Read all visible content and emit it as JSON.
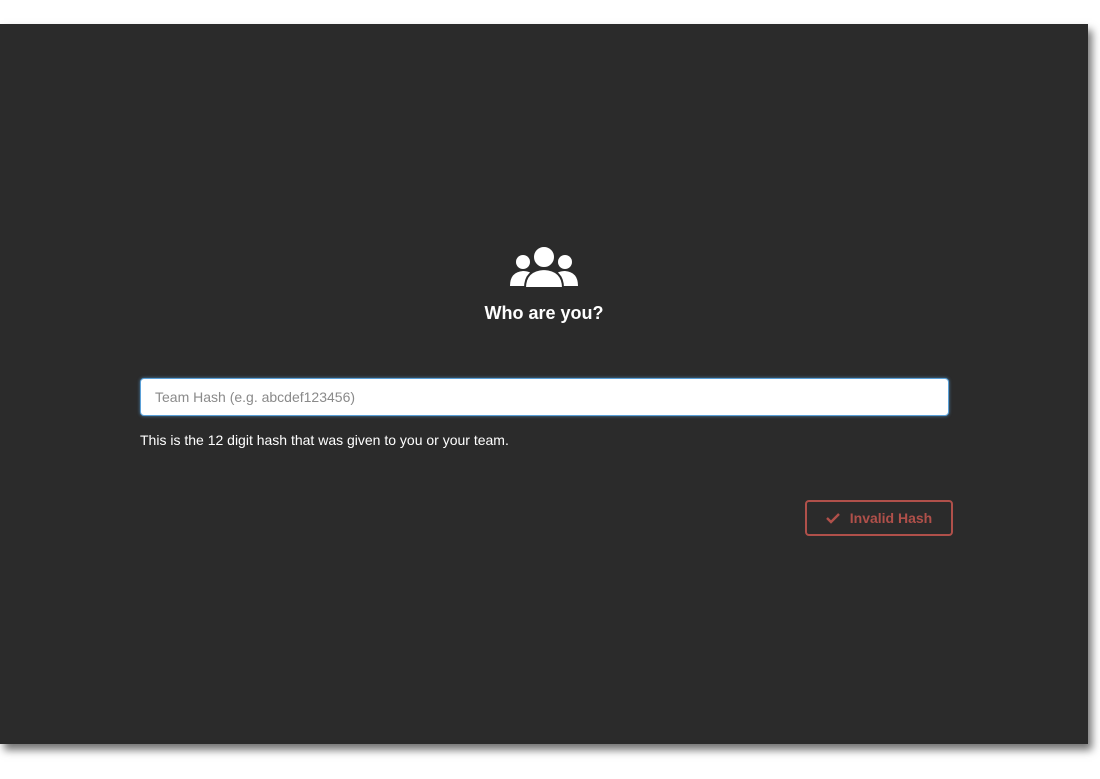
{
  "header": {
    "icon": "users-icon",
    "title": "Who are you?"
  },
  "form": {
    "hash_placeholder": "Team Hash (e.g. abcdef123456)",
    "hash_value": "",
    "help_text": "This is the 12 digit hash that was given to you or your team."
  },
  "submit": {
    "icon": "check-icon",
    "label": "Invalid Hash",
    "color": "#b0504a"
  },
  "colors": {
    "background": "#2b2b2b",
    "input_focus_border": "#5aa0d8"
  }
}
